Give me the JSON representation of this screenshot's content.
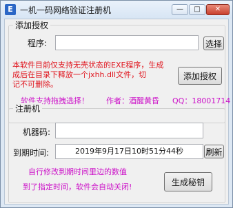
{
  "window": {
    "title": "一机一码网络验证注册机",
    "icon": "app-icon",
    "icon_glyph": "E",
    "minimize": "—",
    "maximize": "□",
    "close": "✕"
  },
  "colors": {
    "warning": "#e0141d",
    "info": "#cc11c8"
  },
  "auth_group": {
    "title": "添加授权",
    "program_label": "程序:",
    "program_value": "",
    "browse_button": "选择",
    "notice_line1": "本软件目前仅支持无壳状态的EXE程序，生成",
    "notice_line2": "成后在目录下释放一个jxhh.dll文件，切",
    "notice_line3": "记不可删除。",
    "add_button": "添加授权",
    "drag_tip": "软件支持拖拽选择！",
    "author": "作者：酒醒黄昏",
    "qq": "QQ：18001714"
  },
  "reg_group": {
    "title": "注册机",
    "machine_label": "机器码:",
    "machine_value": "",
    "expiry_label": "到期时间:",
    "expiry_value": "2019年9月17日10时51分44秒",
    "refresh_button": "刷新",
    "hint_line1": "自行修改到期时间里边的数值",
    "hint_line2": "到了指定时间，软件会自动关闭!",
    "generate_button": "生成秘钥"
  }
}
